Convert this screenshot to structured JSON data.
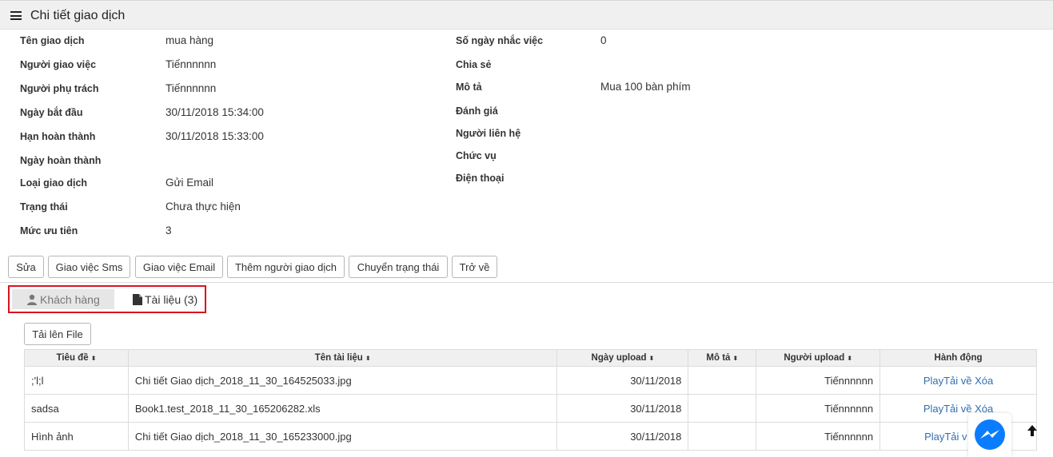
{
  "header": {
    "title": "Chi tiết giao dịch"
  },
  "details_left": [
    {
      "label": "Tên giao dịch",
      "value": "mua hàng"
    },
    {
      "label": "Người giao việc",
      "value": "Tiếnnnnnn"
    },
    {
      "label": "Người phụ trách",
      "value": "Tiếnnnnnn"
    },
    {
      "label": "Ngày bắt đầu",
      "value": "30/11/2018 15:34:00"
    },
    {
      "label": "Hạn hoàn thành",
      "value": "30/11/2018 15:33:00"
    },
    {
      "label": "Ngày hoàn thành",
      "value": ""
    },
    {
      "label": "Loại giao dịch",
      "value": "Gửi Email"
    },
    {
      "label": "Trạng thái",
      "value": "Chưa thực hiện"
    },
    {
      "label": "Mức ưu tiên",
      "value": "3"
    }
  ],
  "details_right": [
    {
      "label": "Số ngày nhắc việc",
      "value": "0"
    },
    {
      "label": "Chia sẻ",
      "value": ""
    },
    {
      "label": "Mô tả",
      "value": "Mua 100 bàn phím"
    },
    {
      "label": "Đánh giá",
      "value": ""
    },
    {
      "label": "Người liên hệ",
      "value": ""
    },
    {
      "label": "Chức vụ",
      "value": ""
    },
    {
      "label": "Điện thoại",
      "value": ""
    }
  ],
  "actions": {
    "edit": "Sửa",
    "assign_sms": "Giao việc Sms",
    "assign_email": "Giao việc Email",
    "add_person": "Thêm người giao dịch",
    "change_status": "Chuyển trạng thái",
    "back": "Trở về"
  },
  "tabs": {
    "customer": "Khách hàng",
    "documents": "Tài liệu (3)"
  },
  "upload_label": "Tải lên File",
  "table": {
    "columns": [
      "Tiêu đề",
      "Tên tài liệu",
      "Ngày upload",
      "Mô tả",
      "Người upload",
      "Hành động"
    ],
    "sort_glyph": "⬍",
    "rows": [
      {
        "title": ";'l;l",
        "filename": "Chi tiết Giao dịch_2018_11_30_164525033.jpg",
        "date": "30/11/2018",
        "desc": "",
        "uploader": "Tiếnnnnnn",
        "action": "PlayTải về Xóa"
      },
      {
        "title": "sadsa",
        "filename": "Book1.test_2018_11_30_165206282.xls",
        "date": "30/11/2018",
        "desc": "",
        "uploader": "Tiếnnnnnn",
        "action": "PlayTải về Xóa"
      },
      {
        "title": "Hình ảnh",
        "filename": "Chi tiết Giao dịch_2018_11_30_165233000.jpg",
        "date": "30/11/2018",
        "desc": "",
        "uploader": "Tiếnnnnnn",
        "action": "PlayTải v"
      }
    ]
  },
  "colors": {
    "accent_link": "#2f6fb0",
    "highlight_border": "#d9141c",
    "messenger": "#0a7cff"
  }
}
